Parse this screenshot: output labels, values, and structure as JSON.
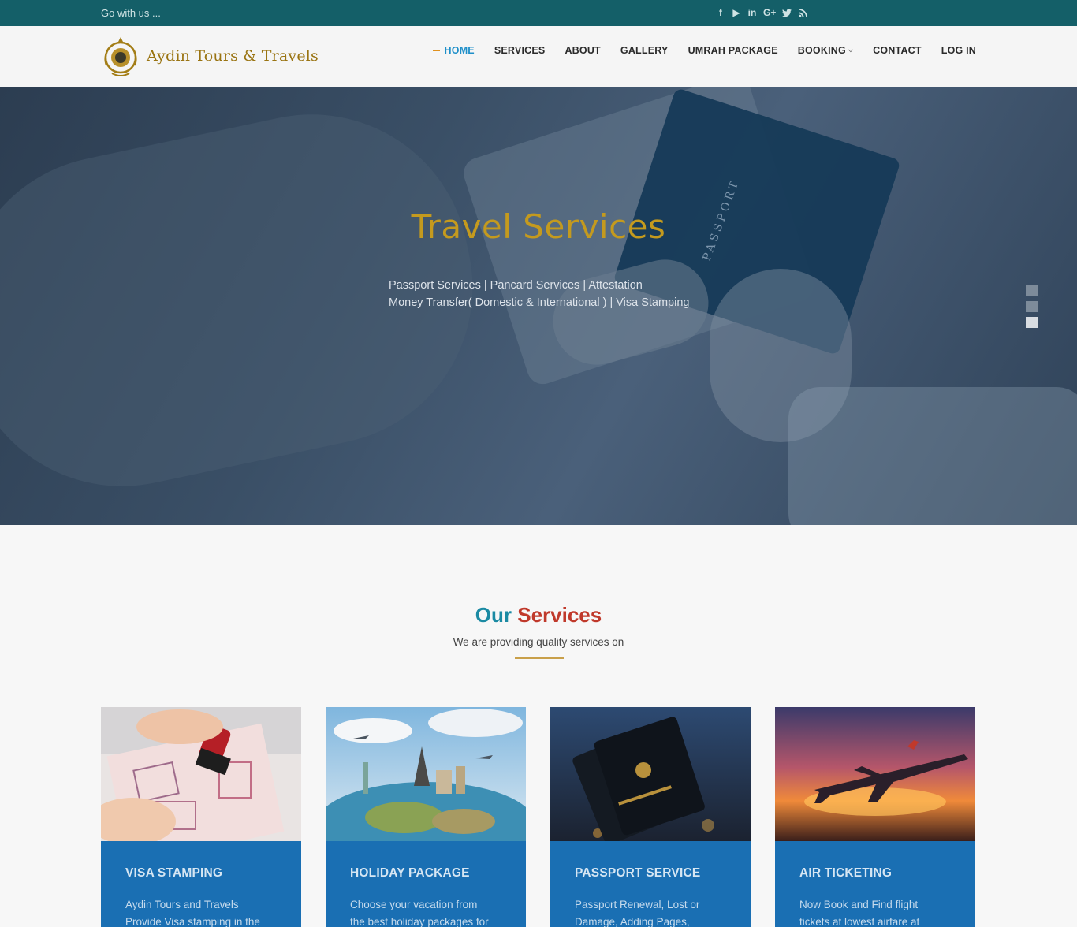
{
  "topbar": {
    "tagline": "Go with us ...",
    "social": [
      {
        "icon": "facebook-icon",
        "glyph": "f"
      },
      {
        "icon": "youtube-icon",
        "glyph": "▶"
      },
      {
        "icon": "linkedin-icon",
        "glyph": "in"
      },
      {
        "icon": "google-plus-icon",
        "glyph": "G+"
      },
      {
        "icon": "twitter-icon",
        "glyph": "🐦"
      },
      {
        "icon": "rss-icon",
        "glyph": "◉"
      }
    ]
  },
  "header": {
    "brand": "Aydin Tours & Travels",
    "nav": [
      {
        "label": "HOME",
        "active": true
      },
      {
        "label": "SERVICES"
      },
      {
        "label": "ABOUT"
      },
      {
        "label": "GALLERY"
      },
      {
        "label": "UMRAH PACKAGE"
      },
      {
        "label": "BOOKING",
        "dropdown": true
      },
      {
        "label": "CONTACT"
      },
      {
        "label": "LOG IN"
      }
    ]
  },
  "hero": {
    "title": "Travel Services",
    "line1": "Passport Services | Pancard Services | Attestation",
    "line2": "Money Transfer( Domestic & International ) | Visa Stamping",
    "passport_text": "PASSPORT",
    "slide_count": 3,
    "active_slide": 3
  },
  "services": {
    "title_part1": "Our",
    "title_part2": "Services",
    "subtitle": "We are providing quality services on",
    "cards": [
      {
        "title": "VISA STAMPING",
        "desc_line1": "Aydin Tours and Travels",
        "desc_line2": "Provide Visa stamping in the"
      },
      {
        "title": "HOLIDAY PACKAGE",
        "desc_line1": "Choose your vacation from",
        "desc_line2": "the best holiday packages for"
      },
      {
        "title": "PASSPORT SERVICE",
        "desc_line1": "Passport Renewal, Lost or",
        "desc_line2": "Damage, Adding Pages,"
      },
      {
        "title": "AIR TICKETING",
        "desc_line1": "Now Book and Find flight",
        "desc_line2": "tickets at lowest airfare at"
      }
    ]
  },
  "colors": {
    "topbar": "#145f68",
    "accent_blue": "#1e8fc9",
    "gold": "#c49a1e",
    "card_blue": "#1a6fb3",
    "title_red": "#c0392b",
    "title_teal": "#1b8aa3"
  }
}
